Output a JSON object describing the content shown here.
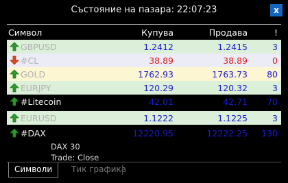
{
  "window": {
    "title": "Състояние на пазара: 22:07:23",
    "close_label": "x"
  },
  "columns": {
    "symbol": "Символ",
    "bid": "Купува",
    "ask": "Продава",
    "count": "!"
  },
  "rows": [
    {
      "symbol": "GBPUSD",
      "bid": "1.2412",
      "ask": "1.2415",
      "count": "3",
      "direction": "up"
    },
    {
      "symbol": "#CL",
      "bid": "38.89",
      "ask": "38.89",
      "count": "0",
      "direction": "down"
    },
    {
      "symbol": "GOLD",
      "bid": "1762.93",
      "ask": "1763.73",
      "count": "80",
      "direction": "up"
    },
    {
      "symbol": "EURJPY",
      "bid": "120.29",
      "ask": "120.32",
      "count": "3",
      "direction": "up"
    },
    {
      "symbol": "#Litecoin",
      "bid": "42.01",
      "ask": "42.71",
      "count": "70",
      "direction": "up"
    },
    {
      "symbol": "EURUSD",
      "bid": "1.1222",
      "ask": "1.1225",
      "count": "3",
      "direction": "up"
    },
    {
      "symbol": "#DAX",
      "bid": "12220.95",
      "ask": "12222.25",
      "count": "130",
      "direction": "up"
    }
  ],
  "details": {
    "name": "DAX 30",
    "trade": "Trade: Close"
  },
  "tabs": {
    "symbols": "Символи",
    "tick_chart": "Тик графика"
  },
  "colors": {
    "close_button": "#1565c0",
    "row_green": "#dcefd8",
    "row_lavender": "#ececf7",
    "row_yellow": "#fdf6d2",
    "price_blue": "#1a1ad6",
    "price_red": "#e01b1b",
    "arrow_up": "#2e9b2e",
    "arrow_down": "#e04a1b"
  }
}
